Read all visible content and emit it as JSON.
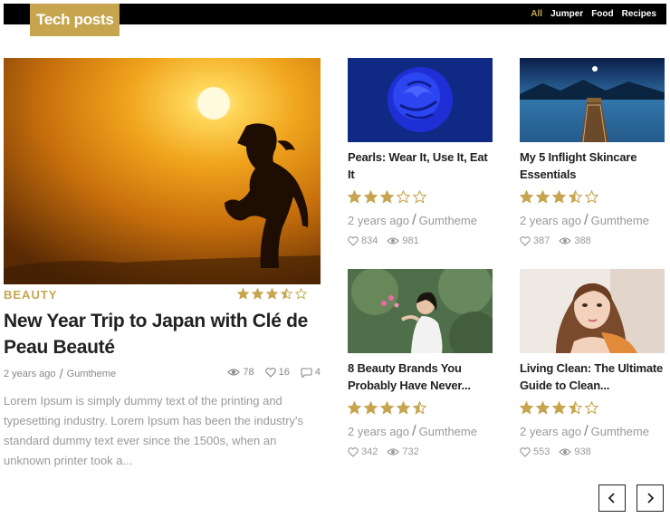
{
  "section": {
    "title": "Tech posts"
  },
  "filters": [
    {
      "label": "All",
      "active": true
    },
    {
      "label": "Jumper",
      "active": false
    },
    {
      "label": "Food",
      "active": false
    },
    {
      "label": "Recipes",
      "active": false
    }
  ],
  "featured": {
    "category": "BEAUTY",
    "title": "New Year Trip to Japan with Clé de Peau Beauté",
    "date": "2 years ago",
    "author": "Gumtheme",
    "rating": 3.5,
    "views": "78",
    "likes": "16",
    "comments": "4",
    "excerpt": "Lorem Ipsum is simply dummy text of the printing and typesetting industry. Lorem Ipsum has been the industry's standard dummy text ever since the 1500s, when an unknown printer took a..."
  },
  "cards": [
    {
      "title": "Pearls: Wear It, Use It, Eat It",
      "rating": 3,
      "date": "2 years ago",
      "author": "Gumtheme",
      "likes": "834",
      "views": "981"
    },
    {
      "title": "My 5 Inflight Skincare Essentials",
      "rating": 3.5,
      "date": "2 years ago",
      "author": "Gumtheme",
      "likes": "387",
      "views": "388"
    },
    {
      "title": "8 Beauty Brands You Probably Have Never...",
      "rating": 4.5,
      "date": "2 years ago",
      "author": "Gumtheme",
      "likes": "342",
      "views": "732"
    },
    {
      "title": "Living Clean: The Ultimate Guide to Clean...",
      "rating": 3.5,
      "date": "2 years ago",
      "author": "Gumtheme",
      "likes": "553",
      "views": "938"
    }
  ],
  "pagination": {
    "prev_icon": "chevron-left-icon",
    "next_icon": "chevron-right-icon"
  },
  "colors": {
    "accent": "#c6a54e",
    "bar": "#000000"
  }
}
